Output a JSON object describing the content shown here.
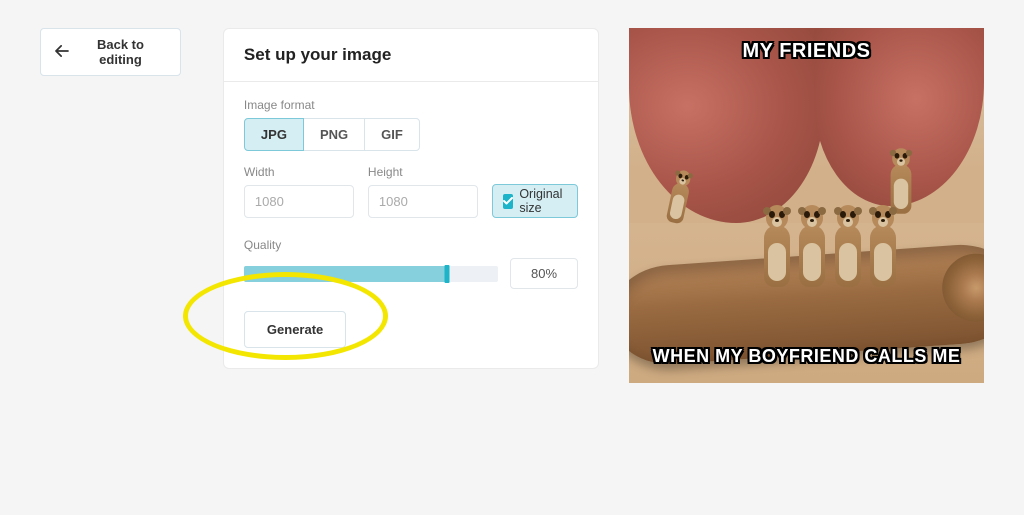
{
  "back_button": {
    "label": "Back to editing"
  },
  "card": {
    "title": "Set up your image",
    "format_label": "Image format",
    "formats": [
      "JPG",
      "PNG",
      "GIF"
    ],
    "selected_format": "JPG",
    "width_label": "Width",
    "width_value": "1080",
    "height_label": "Height",
    "height_value": "1080",
    "original_size_label": "Original size",
    "original_size_checked": true,
    "quality_label": "Quality",
    "quality_percent": 80,
    "quality_display": "80%",
    "generate_label": "Generate"
  },
  "preview": {
    "meme_top": "MY FRIENDS",
    "meme_bottom": "WHEN MY BOYFRIEND CALLS ME"
  },
  "annotation": {
    "highlight_target": "generate-button"
  }
}
